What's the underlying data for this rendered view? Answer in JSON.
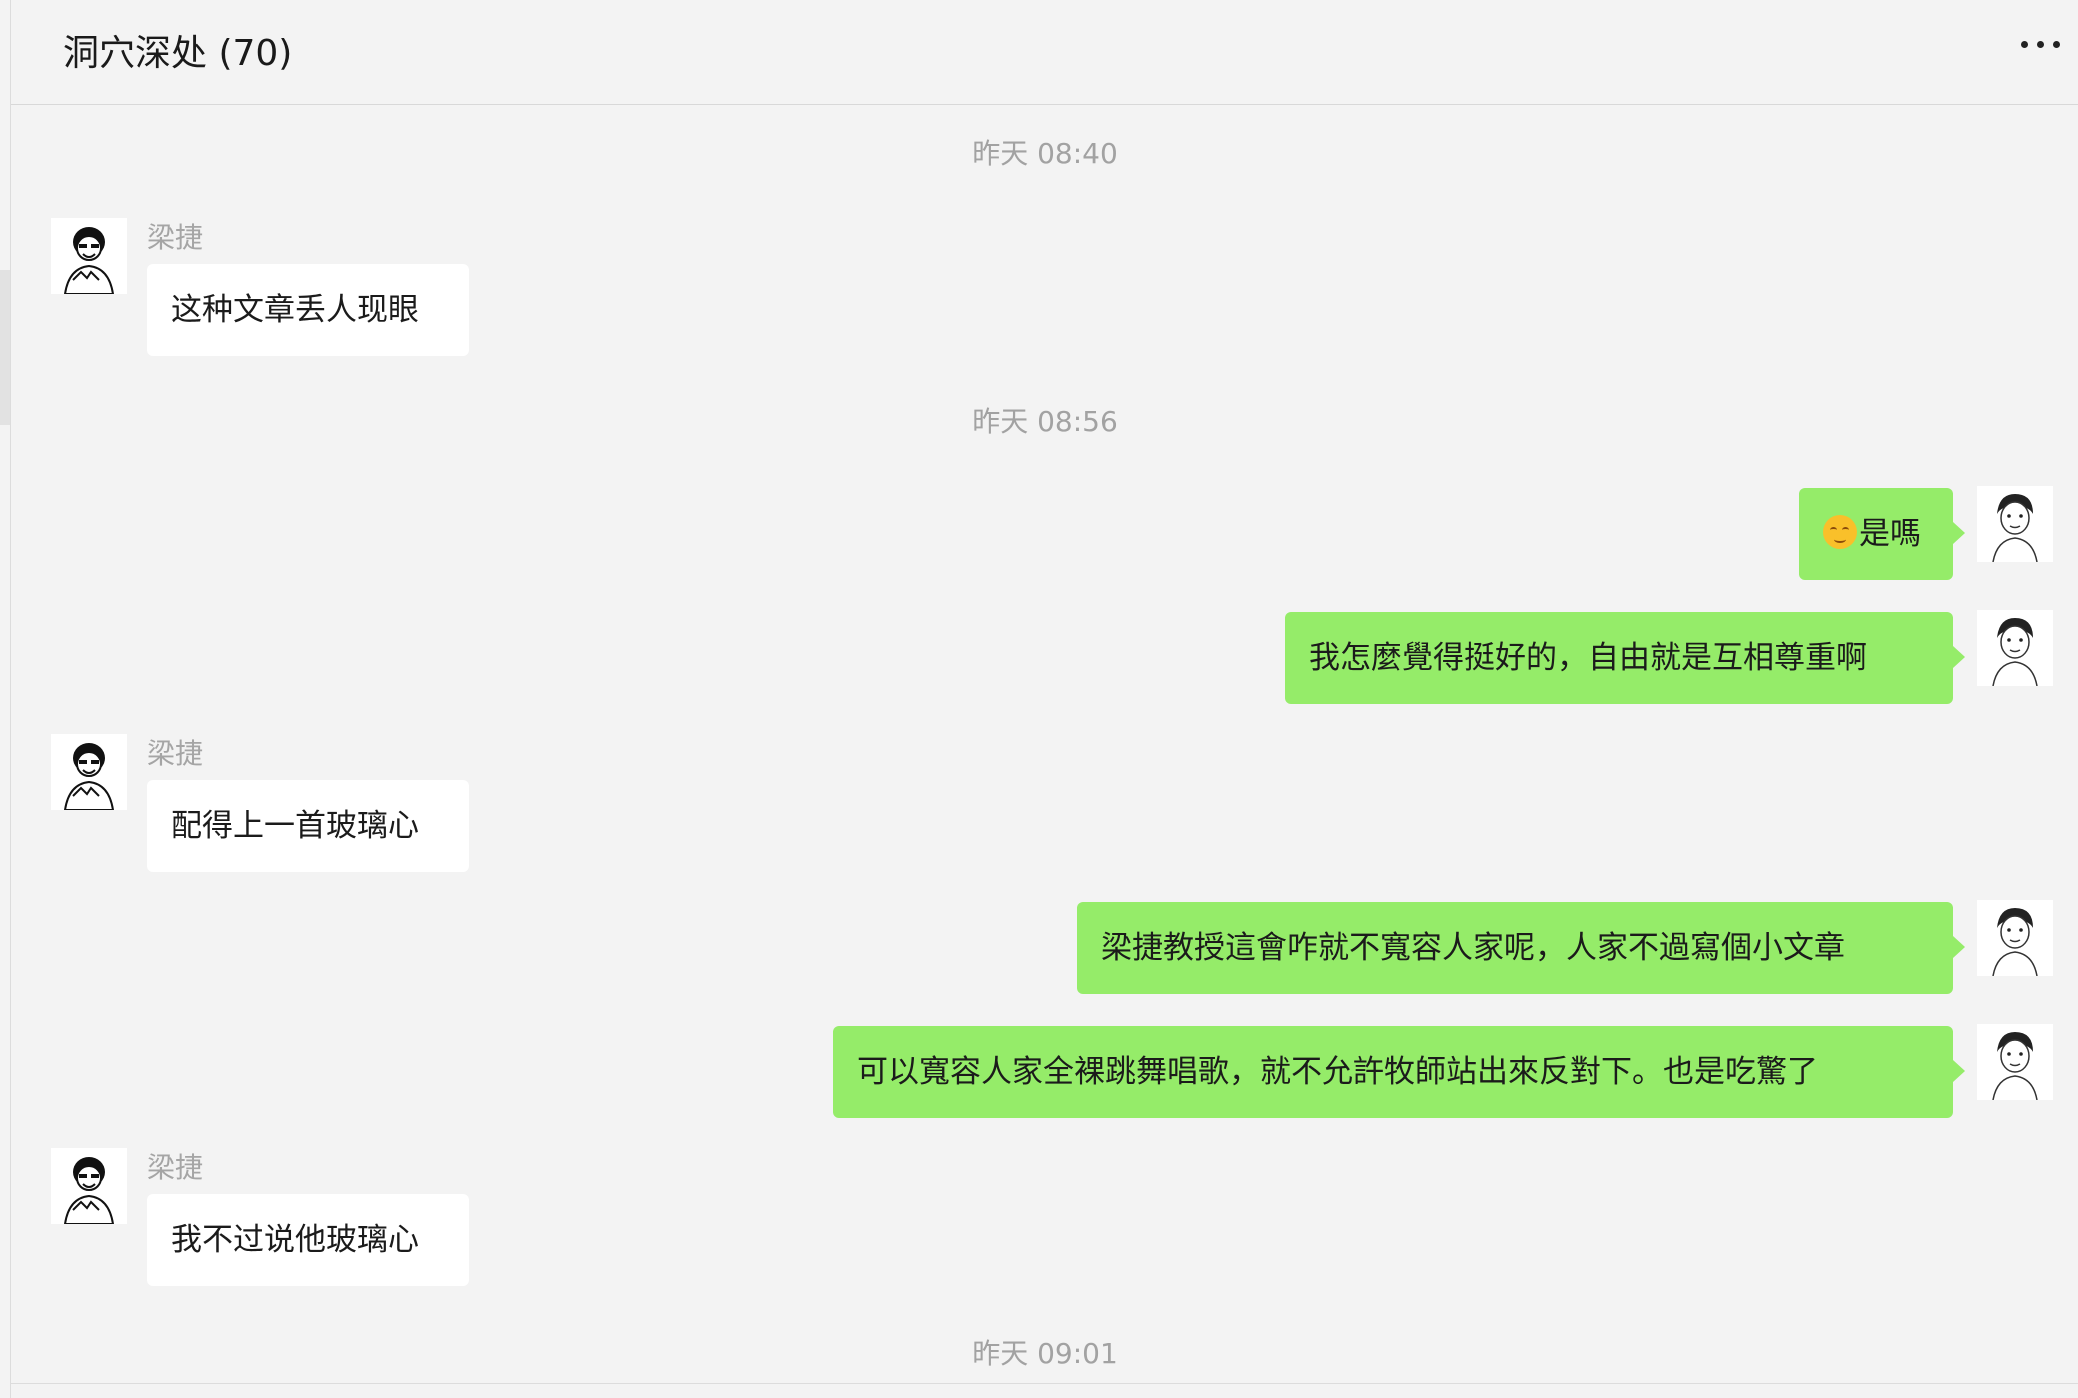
{
  "header": {
    "title": "洞穴深处 (70)",
    "more_icon": "more-icon"
  },
  "messages": [
    {
      "type": "time",
      "text": "昨天 08:40"
    },
    {
      "type": "in",
      "sender": "梁捷",
      "text": "这种文章丢人现眼",
      "avatar_icon": "avatar-icon"
    },
    {
      "type": "time",
      "text": "昨天 08:56"
    },
    {
      "type": "out",
      "text": "是嗎",
      "emoji_icon": "smiling-face-emoji-icon",
      "avatar_icon": "avatar-icon"
    },
    {
      "type": "out",
      "text": "我怎麼覺得挺好的，自由就是互相尊重啊",
      "avatar_icon": "avatar-icon"
    },
    {
      "type": "in",
      "sender": "梁捷",
      "text": "配得上一首玻璃心",
      "avatar_icon": "avatar-icon"
    },
    {
      "type": "out",
      "text": "梁捷教授這會咋就不寬容人家呢，人家不過寫個小文章",
      "avatar_icon": "avatar-icon"
    },
    {
      "type": "out",
      "text": "可以寬容人家全裸跳舞唱歌，就不允許牧師站出來反對下。也是吃驚了",
      "avatar_icon": "avatar-icon"
    },
    {
      "type": "in",
      "sender": "梁捷",
      "text": "我不过说他玻璃心",
      "avatar_icon": "avatar-icon"
    },
    {
      "type": "time",
      "text": "昨天 09:01"
    }
  ],
  "colors": {
    "background": "#f3f3f3",
    "incoming_bubble": "#ffffff",
    "outgoing_bubble": "#95ec69",
    "timestamp_text": "#a2a2a2"
  }
}
